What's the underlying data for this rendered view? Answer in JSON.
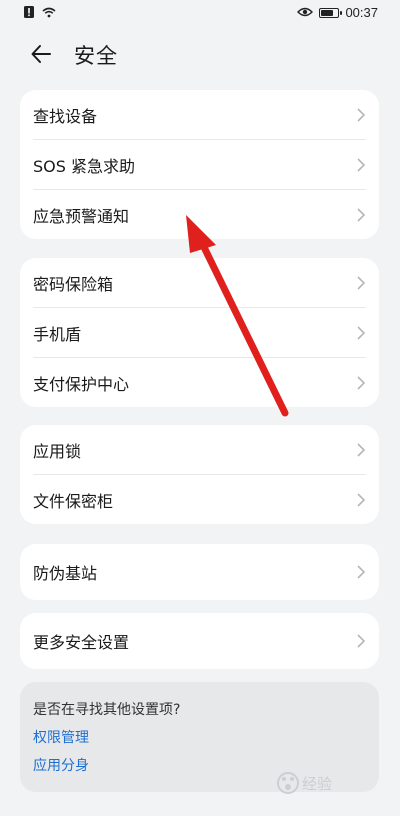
{
  "status_bar": {
    "time": "00:37",
    "battery_level": 0.8
  },
  "header": {
    "title": "安全"
  },
  "groups": [
    {
      "items": [
        {
          "label": "查找设备"
        },
        {
          "label": "SOS 紧急求助"
        },
        {
          "label": "应急预警通知"
        }
      ]
    },
    {
      "items": [
        {
          "label": "密码保险箱"
        },
        {
          "label": "手机盾"
        },
        {
          "label": "支付保护中心"
        }
      ]
    },
    {
      "items": [
        {
          "label": "应用锁"
        },
        {
          "label": "文件保密柜"
        }
      ]
    },
    {
      "items": [
        {
          "label": "防伪基站"
        }
      ]
    },
    {
      "items": [
        {
          "label": "更多安全设置"
        }
      ]
    }
  ],
  "suggestions": {
    "question": "是否在寻找其他设置项?",
    "links": [
      {
        "label": "权限管理"
      },
      {
        "label": "应用分身"
      }
    ]
  },
  "watermark": "Baidu 经验",
  "colors": {
    "background": "#f1f3f5",
    "card": "#ffffff",
    "link": "#1f6fd1",
    "annotation_arrow": "#e0201c"
  }
}
